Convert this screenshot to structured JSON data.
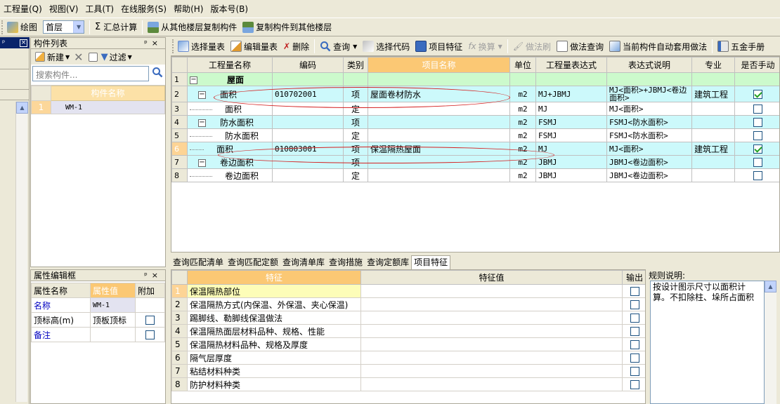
{
  "menu": [
    "工程量(Q)",
    "视图(V)",
    "工具(T)",
    "在线服务(S)",
    "帮助(H)",
    "版本号(B)"
  ],
  "toolbar": {
    "draw": "绘图",
    "floor": "首层",
    "summary": "汇总计算",
    "copy_from": "从其他楼层复制构件",
    "copy_to": "复制构件到其他楼层"
  },
  "comp_list": {
    "title": "构件列表",
    "new": "新建",
    "filter": "过滤",
    "search_placeholder": "搜索构件...",
    "col_name": "构件名称",
    "rows": [
      {
        "num": "1",
        "name": "WM-1"
      }
    ]
  },
  "props": {
    "title": "属性编辑框",
    "headers": [
      "属性名称",
      "属性值",
      "附加"
    ],
    "rows": [
      {
        "name": "名称",
        "value": "WM-1",
        "blue": true,
        "checkbox": false
      },
      {
        "name": "顶标高(m)",
        "value": "顶板顶标",
        "blue": false,
        "checkbox": true
      },
      {
        "name": "备注",
        "value": "",
        "blue": true,
        "checkbox": true
      }
    ]
  },
  "qtoolbar": {
    "select_list": "选择量表",
    "edit_list": "编辑量表",
    "delete": "删除",
    "query": "查询",
    "select_code": "选择代码",
    "item_feature": "项目特征",
    "convert": "换算",
    "method_brush": "做法刷",
    "method_query": "做法查询",
    "auto_apply": "当前构件自动套用做法",
    "hardware": "五金手册"
  },
  "grid": {
    "headers": [
      "",
      "工程量名称",
      "编码",
      "类别",
      "项目名称",
      "单位",
      "工程量表达式",
      "表达式说明",
      "专业",
      "是否手动"
    ],
    "rows": [
      {
        "num": "1",
        "tree": "−",
        "indent": 0,
        "name": "屋面",
        "code": "",
        "type": "",
        "proj": "",
        "unit": "",
        "expr": "",
        "desc": "",
        "major": "",
        "manual": null,
        "style": "green",
        "bold": true
      },
      {
        "num": "2",
        "tree": "−",
        "indent": 1,
        "name": "面积",
        "code": "010702001",
        "type": "项",
        "proj": "屋面卷材防水",
        "unit": "m2",
        "expr": "MJ+JBMJ",
        "desc": "MJ<面积>+JBMJ<卷边面积>",
        "major": "建筑工程",
        "manual": true,
        "style": "cyan"
      },
      {
        "num": "3",
        "tree": "",
        "indent": 2,
        "name": "面积",
        "code": "",
        "type": "定",
        "proj": "",
        "unit": "m2",
        "expr": "MJ",
        "desc": "MJ<面积>",
        "major": "",
        "manual": false,
        "style": "white"
      },
      {
        "num": "4",
        "tree": "−",
        "indent": 1,
        "name": "防水面积",
        "code": "",
        "type": "项",
        "proj": "",
        "unit": "m2",
        "expr": "FSMJ",
        "desc": "FSMJ<防水面积>",
        "major": "",
        "manual": false,
        "style": "cyan"
      },
      {
        "num": "5",
        "tree": "",
        "indent": 2,
        "name": "防水面积",
        "code": "",
        "type": "定",
        "proj": "",
        "unit": "m2",
        "expr": "FSMJ",
        "desc": "FSMJ<防水面积>",
        "major": "",
        "manual": false,
        "style": "white"
      },
      {
        "num": "6",
        "tree": "",
        "indent": 1,
        "name": "面积",
        "code": "010803001",
        "type": "项",
        "proj": "保温隔热屋面",
        "unit": "m2",
        "expr": "MJ",
        "desc": "MJ<面积>",
        "major": "建筑工程",
        "manual": true,
        "style": "cyan",
        "selected": true
      },
      {
        "num": "7",
        "tree": "−",
        "indent": 1,
        "name": "卷边面积",
        "code": "",
        "type": "项",
        "proj": "",
        "unit": "m2",
        "expr": "JBMJ",
        "desc": "JBMJ<卷边面积>",
        "major": "",
        "manual": false,
        "style": "cyan"
      },
      {
        "num": "8",
        "tree": "",
        "indent": 2,
        "name": "卷边面积",
        "code": "",
        "type": "定",
        "proj": "",
        "unit": "m2",
        "expr": "JBMJ",
        "desc": "JBMJ<卷边面积>",
        "major": "",
        "manual": false,
        "style": "white"
      }
    ]
  },
  "tabs": [
    "查询匹配清单",
    "查询匹配定额",
    "查询清单库",
    "查询措施",
    "查询定额库",
    "项目特征"
  ],
  "active_tab": 5,
  "features": {
    "headers": [
      "",
      "特征",
      "特征值",
      "输出"
    ],
    "rows": [
      "保温隔热部位",
      "保温隔热方式(内保温、外保温、夹心保温)",
      "踢脚线、勒脚线保温做法",
      "保温隔热面层材料品种、规格、性能",
      "保温隔热材料品种、规格及厚度",
      "隔气层厚度",
      "粘结材料种类",
      "防护材料种类"
    ]
  },
  "rules": {
    "title": "规则说明:",
    "text": "按设计图示尺寸以面积计算。不扣除柱、垛所占面积"
  },
  "colors": {
    "accent_header": "#fbc874",
    "row_cyan": "#ccf9fb",
    "row_green": "#ccfacc",
    "highlight_ellipse": "#d42020"
  }
}
